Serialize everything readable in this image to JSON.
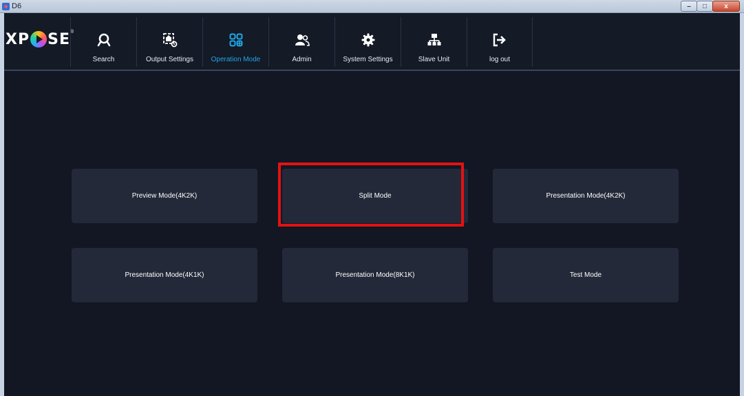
{
  "window": {
    "title": "D6",
    "controls": [
      "minimize",
      "maximize",
      "close"
    ],
    "minimize_glyph": "–",
    "maximize_glyph": "□",
    "close_glyph": "x"
  },
  "logo": {
    "text_left": "X",
    "text_mid": "P",
    "text_right": "SE",
    "reg": "®"
  },
  "nav": {
    "active_color": "#1ea8e8",
    "items": [
      {
        "label": "Search",
        "icon": "search-icon"
      },
      {
        "label": "Output Settings",
        "icon": "output-settings-icon"
      },
      {
        "label": "Operation Mode",
        "icon": "operation-mode-icon",
        "active": true
      },
      {
        "label": "Admin",
        "icon": "admin-icon"
      },
      {
        "label": "System Settings",
        "icon": "system-settings-icon"
      },
      {
        "label": "Slave Unit",
        "icon": "slave-unit-icon"
      },
      {
        "label": "log out",
        "icon": "logout-icon"
      }
    ]
  },
  "modes": [
    {
      "label": "Preview Mode(4K2K)"
    },
    {
      "label": "Split Mode",
      "highlighted": true
    },
    {
      "label": "Presentation Mode(4K2K)"
    },
    {
      "label": "Presentation Mode(4K1K)"
    },
    {
      "label": "Presentation Mode(8K1K)"
    },
    {
      "label": "Test Mode"
    }
  ],
  "colors": {
    "background": "#121723",
    "tile": "#232939",
    "highlight": "#e31212"
  }
}
